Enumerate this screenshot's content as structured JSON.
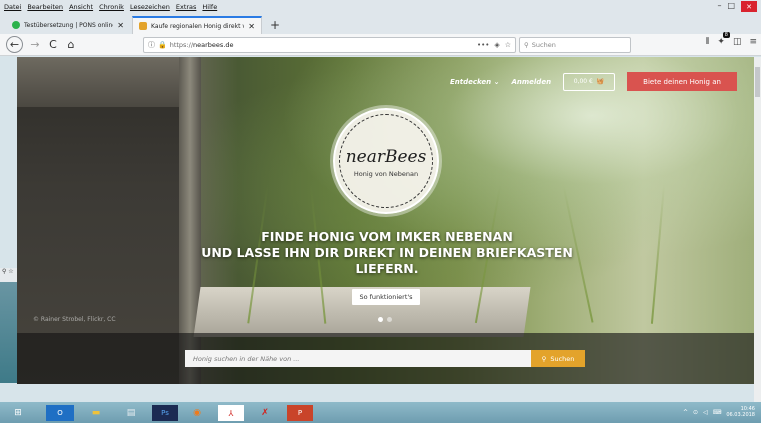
{
  "menubar": {
    "items": [
      "Datei",
      "Bearbeiten",
      "Ansicht",
      "Chronik",
      "Lesezeichen",
      "Extras",
      "Hilfe"
    ]
  },
  "window_controls": {
    "minimize": "–",
    "maximize": "□",
    "close": "✕"
  },
  "tabs": [
    {
      "label": "Testübersetzung | PONS online",
      "close": "✕",
      "active": false,
      "favicon_color": "#2bb24c"
    },
    {
      "label": "Kaufe regionalen Honig direkt v",
      "close": "✕",
      "active": true,
      "favicon_color": "#e3a32b"
    }
  ],
  "newtab_label": "+",
  "nav": {
    "back": "←",
    "forward": "→",
    "reload": "C",
    "home": "⌂",
    "url_prefix": "https://",
    "url_host": "nearbees.de",
    "more": "•••",
    "search_placeholder": "Suchen"
  },
  "toolbar_right": {
    "library": "⫴",
    "badge": "8",
    "sidebar": "◫",
    "menu": "≡"
  },
  "site": {
    "nav_discover": "Entdecken",
    "nav_login": "Anmelden",
    "cart": "0,00 €",
    "cta": "Biete deinen Honig an",
    "logo_name": "nearBees",
    "logo_sub": "Honig von Nebenan",
    "headline": [
      "FINDE HONIG VOM IMKER NEBENAN",
      "UND LASSE IHN DIR DIREKT IN DEINEN BRIEFKASTEN",
      "LIEFERN."
    ],
    "how_button": "So funktioniert's",
    "credit": "© Rainer Strobel, Flickr, CC",
    "search_placeholder": "Honig suchen in der Nähe von ...",
    "search_button": "Suchen"
  },
  "tray": {
    "time": "10:46",
    "date": "06.03.2018"
  },
  "colors": {
    "cta": "#d9534f",
    "search_button": "#e3a32b",
    "tab_accent": "#2a7be4"
  }
}
